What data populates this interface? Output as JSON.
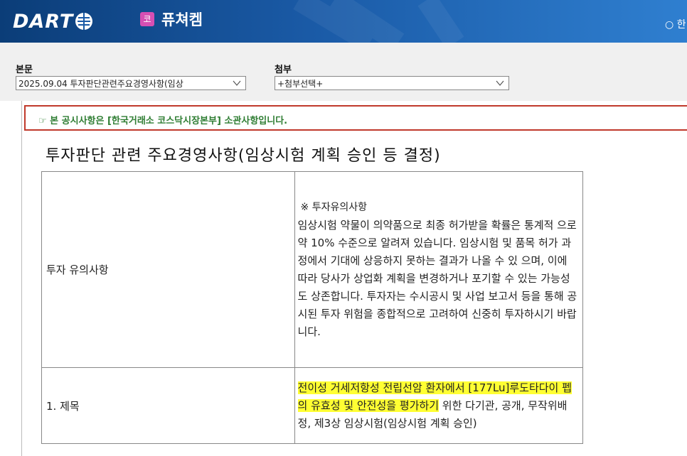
{
  "header": {
    "logo": "DART",
    "company_badge": "코",
    "company_name": "퓨쳐켐",
    "top_right_text": "○ 한"
  },
  "toolbar": {
    "body_label": "본문",
    "body_select_value": "2025.09.04   투자판단관련주요경영사항(임상",
    "attach_label": "첨부",
    "attach_select_value": "+첨부선택+"
  },
  "notice": {
    "text": "☞ 본 공시사항은 [한국거래소 코스닥시장본부] 소관사항입니다."
  },
  "document": {
    "title": "투자판단 관련 주요경영사항(임상시험 계획 승인 등 결정)",
    "rows": [
      {
        "label": "투자 유의사항",
        "heading": "※ 투자유의사항",
        "text": "임상시험 약물이 의약품으로 최종 허가받을 확률은 통계적 으로 약 10% 수준으로 알려져 있습니다. 임상시험 및 품목 허가 과정에서 기대에 상응하지 못하는 결과가 나올 수 있 으며, 이에 따라 당사가 상업화 계획을 변경하거나 포기할 수 있는 가능성도 상존합니다. 투자자는 수시공시 및 사업 보고서 등을 통해 공시된 투자 위험을 종합적으로 고려하여 신중히 투자하시기 바랍니다."
      },
      {
        "label": "1. 제목",
        "text_highlight": "전이성 거세저항성 전립선암 환자에서 [177Lu]루도타다이 펩의 유효성 및 안전성을 평가하기",
        "text_rest": " 위한 다기관, 공개, 무작위배정, 제3상 임상시험(임상시험 계획 승인)"
      }
    ]
  }
}
